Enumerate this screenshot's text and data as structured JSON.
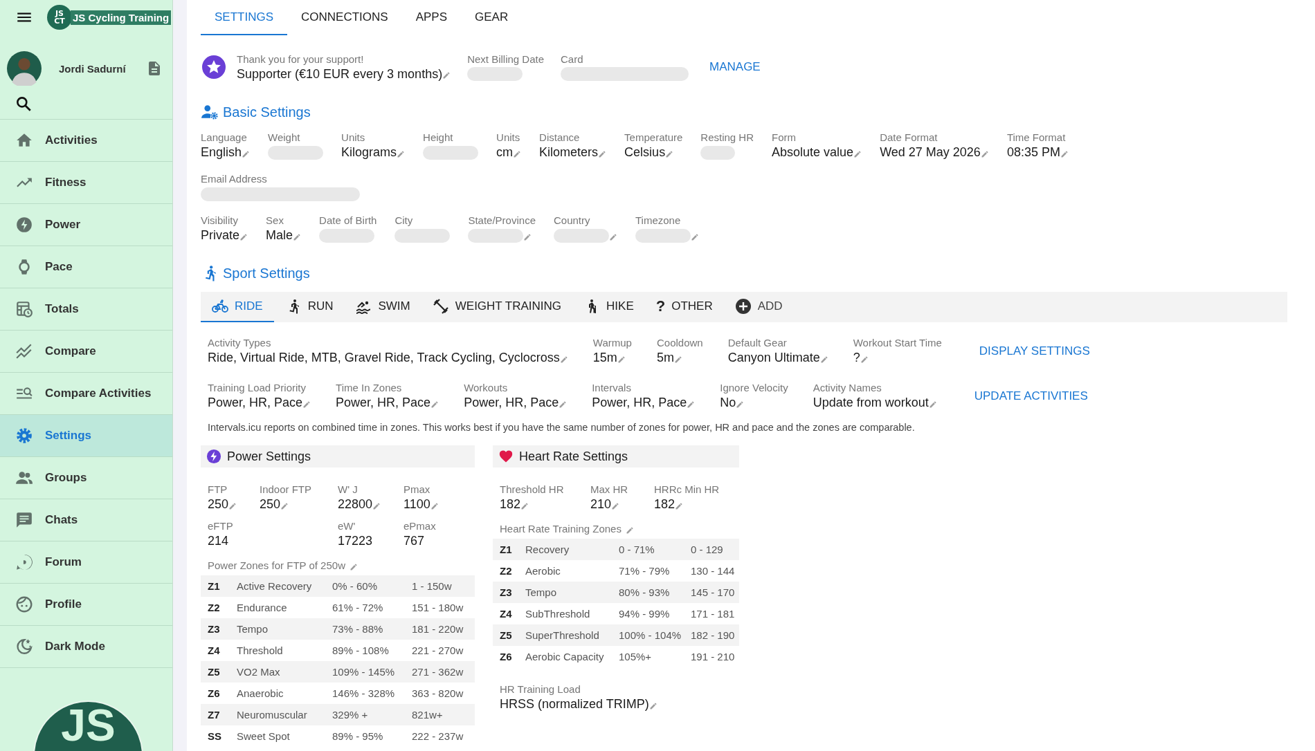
{
  "sidebar": {
    "logo": {
      "mark_lines": [
        "JS",
        "CT"
      ],
      "title": "JS Cycling Training"
    },
    "user": {
      "name": "Jordi Sadurní"
    },
    "items": [
      {
        "label": "Activities",
        "selected": false
      },
      {
        "label": "Fitness",
        "selected": false
      },
      {
        "label": "Power",
        "selected": false
      },
      {
        "label": "Pace",
        "selected": false
      },
      {
        "label": "Totals",
        "selected": false
      },
      {
        "label": "Compare",
        "selected": false
      },
      {
        "label": "Compare Activities",
        "selected": false
      },
      {
        "label": "Settings",
        "selected": true
      },
      {
        "label": "Groups",
        "selected": false
      },
      {
        "label": "Chats",
        "selected": false
      },
      {
        "label": "Forum",
        "selected": false
      },
      {
        "label": "Profile",
        "selected": false
      },
      {
        "label": "Dark Mode",
        "selected": false
      }
    ],
    "bottom_logo": {
      "mark": "JS"
    }
  },
  "tabs": [
    {
      "label": "SETTINGS",
      "selected": true
    },
    {
      "label": "CONNECTIONS",
      "selected": false
    },
    {
      "label": "APPS",
      "selected": false
    },
    {
      "label": "GEAR",
      "selected": false
    }
  ],
  "subscription": {
    "fields": [
      {
        "label": "Thank you for your support!",
        "value": "Supporter (€10 EUR every 3 months)",
        "editable": true
      },
      {
        "label": "Next Billing Date",
        "redacted": true
      },
      {
        "label": "Card",
        "redacted": true
      }
    ],
    "action": "MANAGE"
  },
  "basic_settings": {
    "title": "Basic Settings",
    "rows": [
      [
        {
          "label": "Language",
          "value": "English",
          "editable": true
        },
        {
          "label": "Weight",
          "redacted": true
        },
        {
          "label": "Units",
          "value": "Kilograms",
          "editable": true
        },
        {
          "label": "Height",
          "redacted": true
        },
        {
          "label": "Units",
          "value": "cm",
          "editable": true
        },
        {
          "label": "Distance",
          "value": "Kilometers",
          "editable": true
        },
        {
          "label": "Temperature",
          "value": "Celsius",
          "editable": true
        },
        {
          "label": "Resting HR",
          "redacted": true
        },
        {
          "label": "Form",
          "value": "Absolute value",
          "editable": true
        },
        {
          "label": "Date Format",
          "value": "Wed 27 May 2026",
          "editable": true
        },
        {
          "label": "Time Format",
          "value": "08:35 PM",
          "editable": true
        }
      ],
      [
        {
          "label": "Email Address",
          "redacted": true
        }
      ],
      [
        {
          "label": "Visibility",
          "value": "Private",
          "editable": true
        },
        {
          "label": "Sex",
          "value": "Male",
          "editable": true
        },
        {
          "label": "Date of Birth",
          "redacted": true
        },
        {
          "label": "City",
          "redacted": true
        },
        {
          "label": "State/Province",
          "redacted": true,
          "editable": true
        },
        {
          "label": "Country",
          "redacted": true,
          "editable": true
        },
        {
          "label": "Timezone",
          "redacted": true,
          "editable": true
        }
      ]
    ]
  },
  "sport_settings": {
    "title": "Sport Settings",
    "tabs": [
      {
        "label": "RIDE",
        "kind": "sport",
        "selected": true
      },
      {
        "label": "RUN",
        "kind": "sport",
        "selected": false
      },
      {
        "label": "SWIM",
        "kind": "sport",
        "selected": false
      },
      {
        "label": "WEIGHT TRAINING",
        "kind": "sport",
        "selected": false
      },
      {
        "label": "HIKE",
        "kind": "sport",
        "selected": false
      },
      {
        "label": "OTHER",
        "kind": "sport",
        "glyph": "?",
        "selected": false
      },
      {
        "label": "ADD",
        "kind": "add",
        "selected": false
      }
    ],
    "rows": [
      {
        "fields": [
          {
            "label": "Activity Types",
            "value": "Ride, Virtual Ride, MTB, Gravel Ride, Track Cycling, Cyclocross",
            "editable": true
          },
          {
            "label": "Warmup",
            "value": "15m",
            "editable": true
          },
          {
            "label": "Cooldown",
            "value": "5m",
            "editable": true
          },
          {
            "label": "Default Gear",
            "value": "Canyon Ultimate",
            "editable": true
          },
          {
            "label": "Workout Start Time",
            "value": "?",
            "editable": true
          }
        ],
        "action": "DISPLAY SETTINGS"
      },
      {
        "fields": [
          {
            "label": "Training Load Priority",
            "value": "Power, HR, Pace",
            "editable": true
          },
          {
            "label": "Time In Zones",
            "value": "Power, HR, Pace",
            "editable": true
          },
          {
            "label": "Workouts",
            "value": "Power, HR, Pace",
            "editable": true
          },
          {
            "label": "Intervals",
            "value": "Power, HR, Pace",
            "editable": true
          },
          {
            "label": "Ignore Velocity",
            "value": "No",
            "editable": true
          },
          {
            "label": "Activity Names",
            "value": "Update from workout",
            "editable": true
          }
        ],
        "action": "UPDATE ACTIVITIES"
      }
    ],
    "note": "Intervals.icu reports on combined time in zones. This works best if you have the same number of zones for power, HR and pace and the zones are comparable."
  },
  "power_settings": {
    "title": "Power Settings",
    "fields": [
      {
        "label": "FTP",
        "value": "250",
        "editable": true
      },
      {
        "label": "Indoor FTP",
        "value": "250",
        "editable": true
      },
      {
        "label": "W' J",
        "value": "22800",
        "editable": true
      },
      {
        "label": "Pmax",
        "value": "1100",
        "editable": true
      },
      {
        "label": "eFTP",
        "value": "214",
        "editable": false
      },
      {
        "label": "eW'",
        "value": "17223",
        "editable": false
      },
      {
        "label": "ePmax",
        "value": "767",
        "editable": false
      }
    ],
    "zones_title": "Power Zones for FTP of 250w",
    "zones": [
      {
        "zone": "Z1",
        "name": "Active Recovery",
        "percent": "0% - 60%",
        "range": "1 - 150w"
      },
      {
        "zone": "Z2",
        "name": "Endurance",
        "percent": "61% - 72%",
        "range": "151 - 180w"
      },
      {
        "zone": "Z3",
        "name": "Tempo",
        "percent": "73% - 88%",
        "range": "181 - 220w"
      },
      {
        "zone": "Z4",
        "name": "Threshold",
        "percent": "89% - 108%",
        "range": "221 - 270w"
      },
      {
        "zone": "Z5",
        "name": "VO2 Max",
        "percent": "109% - 145%",
        "range": "271 - 362w"
      },
      {
        "zone": "Z6",
        "name": "Anaerobic",
        "percent": "146% - 328%",
        "range": "363 - 820w"
      },
      {
        "zone": "Z7",
        "name": "Neuromuscular",
        "percent": "329% +",
        "range": "821w+"
      },
      {
        "zone": "SS",
        "name": "Sweet Spot",
        "percent": "89% - 95%",
        "range": "222 - 237w"
      }
    ]
  },
  "heart_rate_settings": {
    "title": "Heart Rate Settings",
    "fields": [
      {
        "label": "Threshold HR",
        "value": "182",
        "editable": true
      },
      {
        "label": "Max HR",
        "value": "210",
        "editable": true
      },
      {
        "label": "HRRc Min HR",
        "value": "182",
        "editable": true
      }
    ],
    "zones_title": "Heart Rate Training Zones",
    "zones": [
      {
        "zone": "Z1",
        "name": "Recovery",
        "percent": "0 - 71%",
        "range": "0 - 129"
      },
      {
        "zone": "Z2",
        "name": "Aerobic",
        "percent": "71% - 79%",
        "range": "130 - 144"
      },
      {
        "zone": "Z3",
        "name": "Tempo",
        "percent": "80% - 93%",
        "range": "145 - 170"
      },
      {
        "zone": "Z4",
        "name": "SubThreshold",
        "percent": "94% - 99%",
        "range": "171 - 181"
      },
      {
        "zone": "Z5",
        "name": "SuperThreshold",
        "percent": "100% - 104%",
        "range": "182 - 190"
      },
      {
        "zone": "Z6",
        "name": "Aerobic Capacity",
        "percent": "105%+",
        "range": "191 - 210"
      }
    ],
    "training_load": {
      "label": "HR Training Load",
      "value": "HRSS (normalized TRIMP)",
      "editable": true
    }
  }
}
